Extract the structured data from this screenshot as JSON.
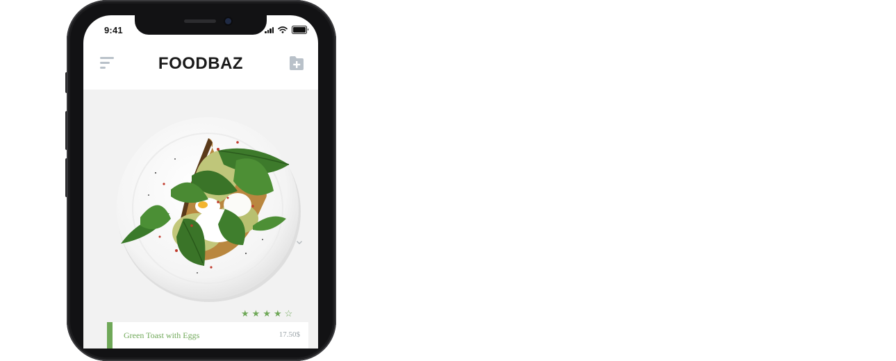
{
  "status_bar": {
    "time": "9:41"
  },
  "app": {
    "title": "FOODBAZ"
  },
  "header": {
    "menu_icon": "menu-icon",
    "add_icon": "add-note-icon"
  },
  "dish": {
    "image": "avocado-toast-with-poached-egg-and-spinach",
    "rating": 4,
    "rating_max": 5,
    "name": "Green Toast with Eggs",
    "price": "17.50$"
  },
  "colors": {
    "accent": "#6fa858",
    "background": "#f2f2f2",
    "icon_gray": "#b9c1c9"
  }
}
